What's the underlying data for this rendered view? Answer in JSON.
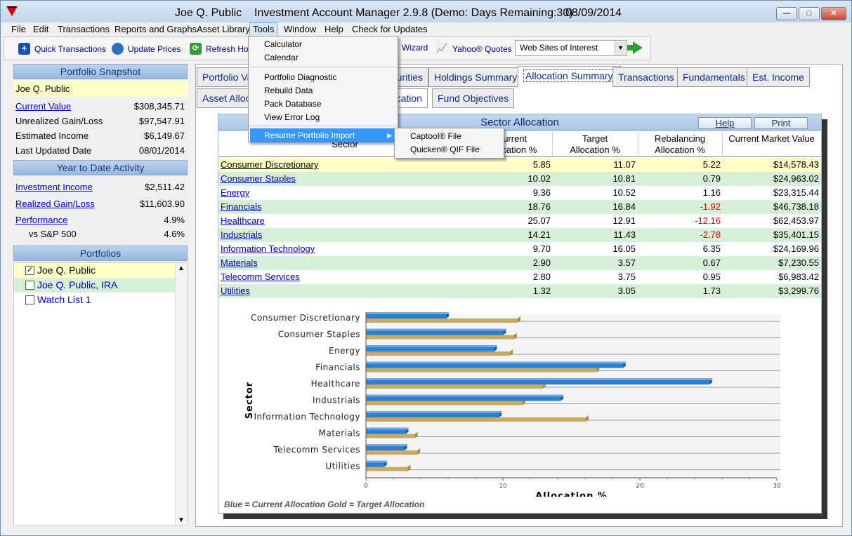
{
  "window": {
    "title_user": "Joe Q. Public",
    "title_app": "Investment Account Manager 2.9.8 (Demo: Days Remaining:30)",
    "title_date": "08/09/2014",
    "btn_min": "—",
    "btn_max": "□",
    "btn_close": "✕"
  },
  "menubar": [
    "File",
    "Edit",
    "Transactions",
    "Reports and Graphs",
    "Asset Library",
    "Tools",
    "Window",
    "Help",
    "Check for Updates"
  ],
  "toolbar": {
    "quick_transactions": "Quick Transactions",
    "update_prices": "Update Prices",
    "refresh_home": "Refresh Home",
    "wizard": "Wizard",
    "yahoo_quotes": "Yahoo® Quotes",
    "websites": "Web Sites of Interest"
  },
  "sidebar": {
    "snapshot_title": "Portfolio Snapshot",
    "snapshot_name": "Joe Q. Public",
    "snapshot": [
      {
        "label": "Current Value",
        "value": "$308,345.71",
        "link": true
      },
      {
        "label": "Unrealized Gain/Loss",
        "value": "$97,547.91",
        "link": false
      },
      {
        "label": "Estimated Income",
        "value": "$6,149.67",
        "link": false
      },
      {
        "label": "Last Updated Date",
        "value": "08/01/2014",
        "link": false
      }
    ],
    "ytd_title": "Year to Date Activity",
    "ytd": [
      {
        "label": "Investment Income",
        "value": "$2,511.42",
        "link": true
      },
      {
        "label": "Realized Gain/Loss",
        "value": "$11,603.90",
        "link": true
      },
      {
        "label": "Performance",
        "value": "4.9%",
        "link": true
      },
      {
        "label": "vs S&P 500",
        "value": "4.6%",
        "link": false
      }
    ],
    "portfolios_title": "Portfolios",
    "portfolios": [
      {
        "name": "Joe Q. Public",
        "checked": true
      },
      {
        "name": "Joe Q. Public, IRA",
        "checked": false
      },
      {
        "name": "Watch List 1",
        "checked": false
      }
    ]
  },
  "tabs_row1": [
    "Portfolio Valuation",
    "Securities",
    "Holdings Summary",
    "Allocation Summary",
    "Transactions",
    "Fundamentals",
    "Est. Income"
  ],
  "tabs_row2": [
    "Asset Allocation",
    "Sector Allocation",
    "Fund Objectives"
  ],
  "panel": {
    "title": "Sector Allocation",
    "help": "Help",
    "print": "Print",
    "col_sector": "Sector",
    "col_current_1": "Current",
    "col_current_2": "Allocation %",
    "col_target_1": "Target",
    "col_target_2": "Allocation %",
    "col_rebal_1": "Rebalancing",
    "col_rebal_2": "Allocation %",
    "col_value": "Current Market Value",
    "rows": [
      {
        "sector": "Consumer Discretionary",
        "current": "5.85",
        "target": "11.07",
        "rebal": "5.22",
        "value": "$14,578.43"
      },
      {
        "sector": "Consumer Staples",
        "current": "10.02",
        "target": "10.81",
        "rebal": "0.79",
        "value": "$24,963.02"
      },
      {
        "sector": "Energy",
        "current": "9.36",
        "target": "10.52",
        "rebal": "1.16",
        "value": "$23,315.44"
      },
      {
        "sector": "Financials",
        "current": "18.76",
        "target": "16.84",
        "rebal": "-1.92",
        "value": "$46,738.18"
      },
      {
        "sector": "Healthcare",
        "current": "25.07",
        "target": "12.91",
        "rebal": "-12.16",
        "value": "$62,453.97"
      },
      {
        "sector": "Industrials",
        "current": "14.21",
        "target": "11.43",
        "rebal": "-2.78",
        "value": "$35,401.15"
      },
      {
        "sector": "Information Technology",
        "current": "9.70",
        "target": "16.05",
        "rebal": "6.35",
        "value": "$24,169.96"
      },
      {
        "sector": "Materials",
        "current": "2.90",
        "target": "3.57",
        "rebal": "0.67",
        "value": "$7,230.55"
      },
      {
        "sector": "Telecomm Services",
        "current": "2.80",
        "target": "3.75",
        "rebal": "0.95",
        "value": "$6,983.42"
      },
      {
        "sector": "Utilities",
        "current": "1.32",
        "target": "3.05",
        "rebal": "1.73",
        "value": "$3,299.76"
      }
    ],
    "legend_note": "Blue = Current Allocation    Gold = Target Allocation"
  },
  "chart_data": {
    "type": "bar",
    "orientation": "horizontal",
    "categories": [
      "Consumer Discretionary",
      "Consumer Staples",
      "Energy",
      "Financials",
      "Healthcare",
      "Industrials",
      "Information Technology",
      "Materials",
      "Telecomm Services",
      "Utilities"
    ],
    "series": [
      {
        "name": "Current Allocation",
        "color": "#2f7fd0",
        "values": [
          5.85,
          10.02,
          9.36,
          18.76,
          25.07,
          14.21,
          9.7,
          2.9,
          2.8,
          1.32
        ]
      },
      {
        "name": "Target Allocation",
        "color": "#c9aa63",
        "values": [
          11.07,
          10.81,
          10.52,
          16.84,
          12.91,
          11.43,
          16.05,
          3.57,
          3.75,
          3.05
        ]
      }
    ],
    "xlabel": "Allocation %",
    "ylabel": "Sector",
    "xlim": [
      0,
      30
    ],
    "xticks": [
      "0",
      "10",
      "20",
      "30"
    ],
    "grid": true
  },
  "tools_menu": {
    "items": [
      "Calculator",
      "Calendar",
      "Portfolio Diagnostic",
      "Rebuild Data",
      "Pack Database",
      "View Error Log"
    ],
    "resume": "Resume Portfolio Import",
    "submenu": [
      "Captool® File",
      "Quicken® QIF File"
    ]
  }
}
